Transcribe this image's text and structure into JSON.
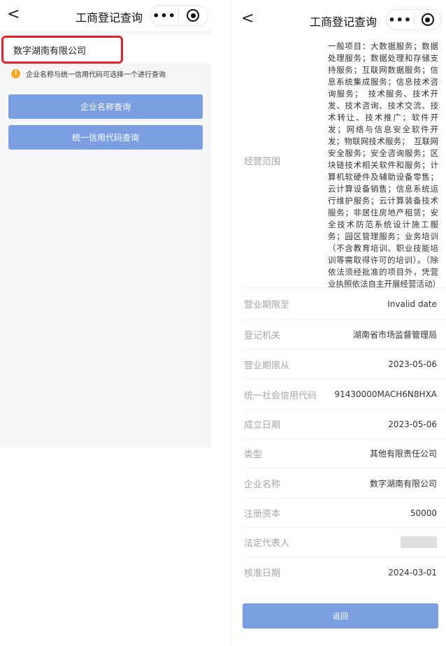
{
  "left": {
    "nav": {
      "back": "<",
      "title": "工商登记查询",
      "more": "•••"
    },
    "search": {
      "value": "数字湖南有限公司"
    },
    "hint": {
      "icon": "!",
      "text": "企业名称与统一信用代码可选择一个进行查询"
    },
    "buttons": {
      "by_name": "企业名称查询",
      "by_code": "统一信用代码查询"
    }
  },
  "right": {
    "nav": {
      "back": "<",
      "title": "工商登记查询",
      "more": "•••"
    },
    "scope": {
      "label": "经营范围",
      "text": "一般项目：大数据服务；数据处理服务；数据处理和存储支持服务；互联网数据服务；信息系统集成服务；信息技术咨询服务；　技术服务、技术开发、技术咨询、技术交流、技术转让、技术推广；软件开发；网络与信息安全软件开发；物联网技术服务；　互联网安全服务；安全咨询服务；区块链技术相关软件和服务；计算机软硬件及辅助设备零售；云计算设备销售；信息系统运行维护服务；云计算装备技术服务；非居住房地产租赁；安全技术防范系统设计施工服务；园区管理服务；业务培训（不含教育培训、职业技能培训等需取得许可的培训）。（除依法须经批准的项目外，凭营业执照依法自主开展经营活动）"
    },
    "fields": [
      {
        "label": "营业期限至",
        "value": "Invalid date"
      },
      {
        "label": "登记机关",
        "value": "湖南省市场监督管理局"
      },
      {
        "label": "营业期限从",
        "value": "2023-05-06"
      },
      {
        "label": "统一社会信用代码",
        "value": "91430000MACH6N8HXA"
      },
      {
        "label": "成立日期",
        "value": "2023-05-06"
      },
      {
        "label": "类型",
        "value": "其他有限责任公司"
      },
      {
        "label": "企业名称",
        "value": "数字湖南有限公司"
      },
      {
        "label": "注册资本",
        "value": "50000"
      },
      {
        "label": "法定代表人",
        "value": ""
      },
      {
        "label": "核准日期",
        "value": "2024-03-01"
      }
    ],
    "back_button": "返回"
  }
}
